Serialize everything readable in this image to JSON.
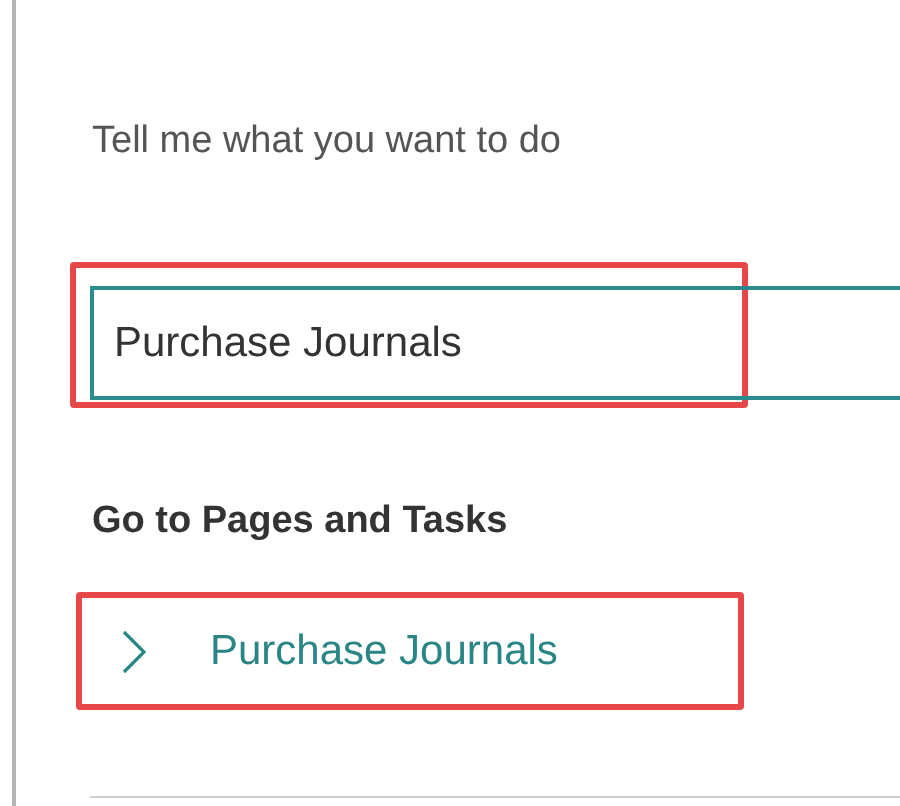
{
  "prompt": "Tell me what you want to do",
  "search": {
    "value": "Purchase Journals"
  },
  "section_heading": "Go to Pages and Tasks",
  "results": [
    {
      "label": "Purchase Journals"
    }
  ]
}
